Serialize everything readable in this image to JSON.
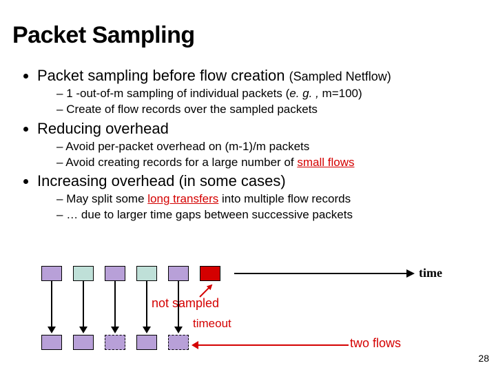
{
  "title": "Packet Sampling",
  "bullets": [
    {
      "text": "Packet sampling before flow creation ",
      "paren": "(Sampled Netflow)",
      "sub": [
        {
          "pre": "1 -out-of-m sampling of individual packets (",
          "em": "e. g. ,",
          "post": " m=100)"
        },
        {
          "pre": "Create of flow records over the sampled packets"
        }
      ]
    },
    {
      "text": "Reducing overhead",
      "sub": [
        {
          "pre": "Avoid per-packet overhead on (m-1)/m packets"
        },
        {
          "pre": "Avoid creating records for a large number of ",
          "hi": "small flows"
        }
      ]
    },
    {
      "text": "Increasing overhead (in some cases)",
      "sub": [
        {
          "pre": "May split some ",
          "hi": "long transfers",
          "post": " into multiple flow records"
        },
        {
          "pre": "… due to larger time gaps between successive packets"
        }
      ]
    }
  ],
  "diagram": {
    "time_label": "time",
    "not_sampled": "not sampled",
    "timeout": "timeout",
    "two_flows": "two flows"
  },
  "slide_number": "28"
}
